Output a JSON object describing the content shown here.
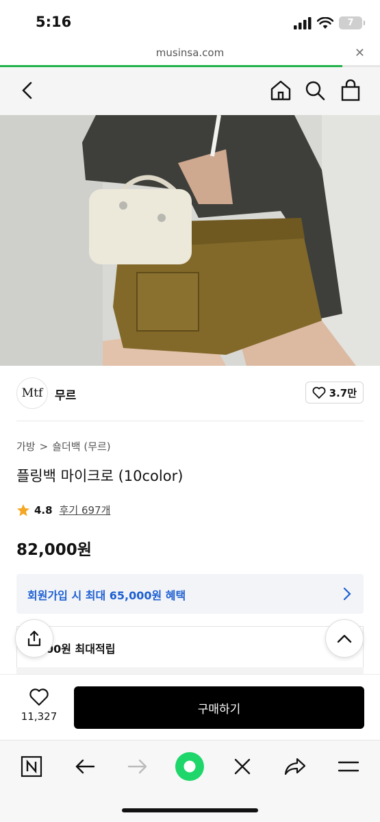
{
  "status_bar": {
    "time": "5:16",
    "battery": "7"
  },
  "browser": {
    "url": "musinsa.com",
    "close_glyph": "✕",
    "load_progress": 0.9,
    "accent": "#20b24a"
  },
  "nav": {
    "back_icon": "chevron-left-icon",
    "home_icon": "home-icon",
    "search_icon": "search-icon",
    "cart_icon": "shopping-bag-icon"
  },
  "brand": {
    "logo_text": "Mtf",
    "name": "무르",
    "likes": "3.7만"
  },
  "breadcrumb": {
    "category": "가방",
    "separator": ">",
    "subcategory": "숄더백 (무르)"
  },
  "product": {
    "title": "플링백 마이크로 (10color)",
    "rating": "4.8",
    "reviews": "후기 697개",
    "price": "82,000원"
  },
  "promo": {
    "text": "회원가입 시 최대 65,000원 혜택",
    "color": "#1d5fd1"
  },
  "points": {
    "text": "00원 최대적립"
  },
  "buy_bar": {
    "wish_count": "11,327",
    "buy_label": "구매하기"
  },
  "toolbar": {
    "items": [
      "naver-icon",
      "back-icon",
      "forward-icon",
      "green-dot-icon",
      "close-icon",
      "share-icon",
      "menu-icon"
    ]
  }
}
